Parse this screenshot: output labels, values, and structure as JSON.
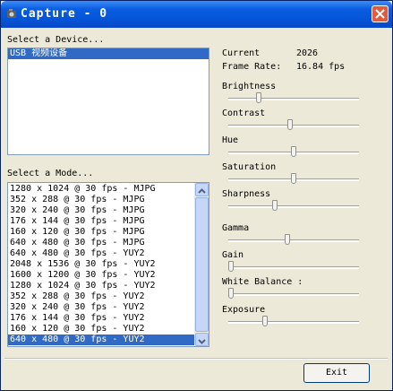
{
  "window": {
    "title": "Capture - 0",
    "close_icon": "close-icon",
    "app_icon": "camera-icon"
  },
  "device": {
    "label": "Select a Device...",
    "items": [
      {
        "label": "USB 视频设备",
        "selected": true
      }
    ]
  },
  "mode": {
    "label": "Select a Mode...",
    "items": [
      {
        "label": "1280 x 1024 @ 30 fps - MJPG",
        "selected": false
      },
      {
        "label": "352 x 288 @ 30 fps - MJPG",
        "selected": false
      },
      {
        "label": "320 x 240 @ 30 fps - MJPG",
        "selected": false
      },
      {
        "label": "176 x 144 @ 30 fps - MJPG",
        "selected": false
      },
      {
        "label": "160 x 120 @ 30 fps - MJPG",
        "selected": false
      },
      {
        "label": "640 x 480 @ 30 fps - MJPG",
        "selected": false
      },
      {
        "label": "640 x 480 @ 30 fps - YUY2",
        "selected": false
      },
      {
        "label": "2048 x 1536 @ 30 fps - YUY2",
        "selected": false
      },
      {
        "label": "1600 x 1200 @ 30 fps - YUY2",
        "selected": false
      },
      {
        "label": "1280 x 1024 @ 30 fps - YUY2",
        "selected": false
      },
      {
        "label": "352 x 288 @ 30 fps - YUY2",
        "selected": false
      },
      {
        "label": "320 x 240 @ 30 fps - YUY2",
        "selected": false
      },
      {
        "label": "176 x 144 @ 30 fps - YUY2",
        "selected": false
      },
      {
        "label": "160 x 120 @ 30 fps - YUY2",
        "selected": false
      },
      {
        "label": "640 x 480 @ 30 fps - YUY2",
        "selected": true
      }
    ]
  },
  "status": {
    "current_label": "Current",
    "current_value": "2026",
    "framerate_label": "Frame Rate:",
    "framerate_value": "16.84 fps"
  },
  "sliders": [
    {
      "label": "Brightness",
      "level": 0.22
    },
    {
      "label": "Contrast",
      "level": 0.47
    },
    {
      "label": "Hue",
      "level": 0.5
    },
    {
      "label": "Saturation",
      "level": 0.5
    },
    {
      "label": "Sharpness",
      "level": 0.35
    },
    {
      "label": "Gamma",
      "level": 0.45
    },
    {
      "label": "Gain",
      "level": 0.0
    },
    {
      "label": "White Balance :",
      "level": 0.0
    },
    {
      "label": "Exposure",
      "level": 0.27
    }
  ],
  "exit_label": "Exit",
  "colors": {
    "selection": "#316ac5",
    "title_bar": "#0454d8",
    "face": "#ece9d8"
  }
}
